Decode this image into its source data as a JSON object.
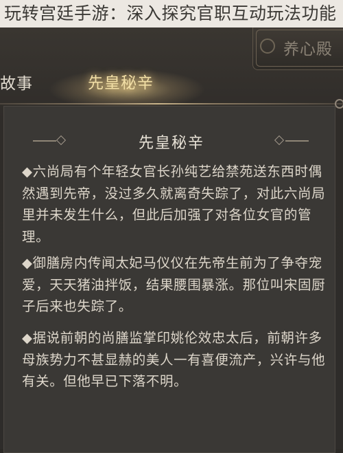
{
  "caption": "玩转宫廷手游：深入探究官职互动玩法功能",
  "tabs": {
    "left_partial": "故事",
    "active": "先皇秘辛",
    "right_partial": "养心殿"
  },
  "panel": {
    "title": "先皇秘辛",
    "paragraphs": [
      "◆六尚局有个年轻女官长孙纯艺给禁苑送东西时偶然遇到先帝，没过多久就离奇失踪了，对此六尚局里并未发生什么，但此后加强了对各位女官的管理。",
      "◆御膳房内传闻太妃马仪仪在先帝生前为了争夺宠爱，天天猪油拌饭，结果腰围暴涨。那位叫宋固厨子后来也失踪了。",
      "◆据说前朝的尚膳监掌印姚伦效忠太后，前朝许多母族势力不甚显赫的美人一有喜便流产，兴许与他有关。但他早已下落不明。"
    ]
  }
}
